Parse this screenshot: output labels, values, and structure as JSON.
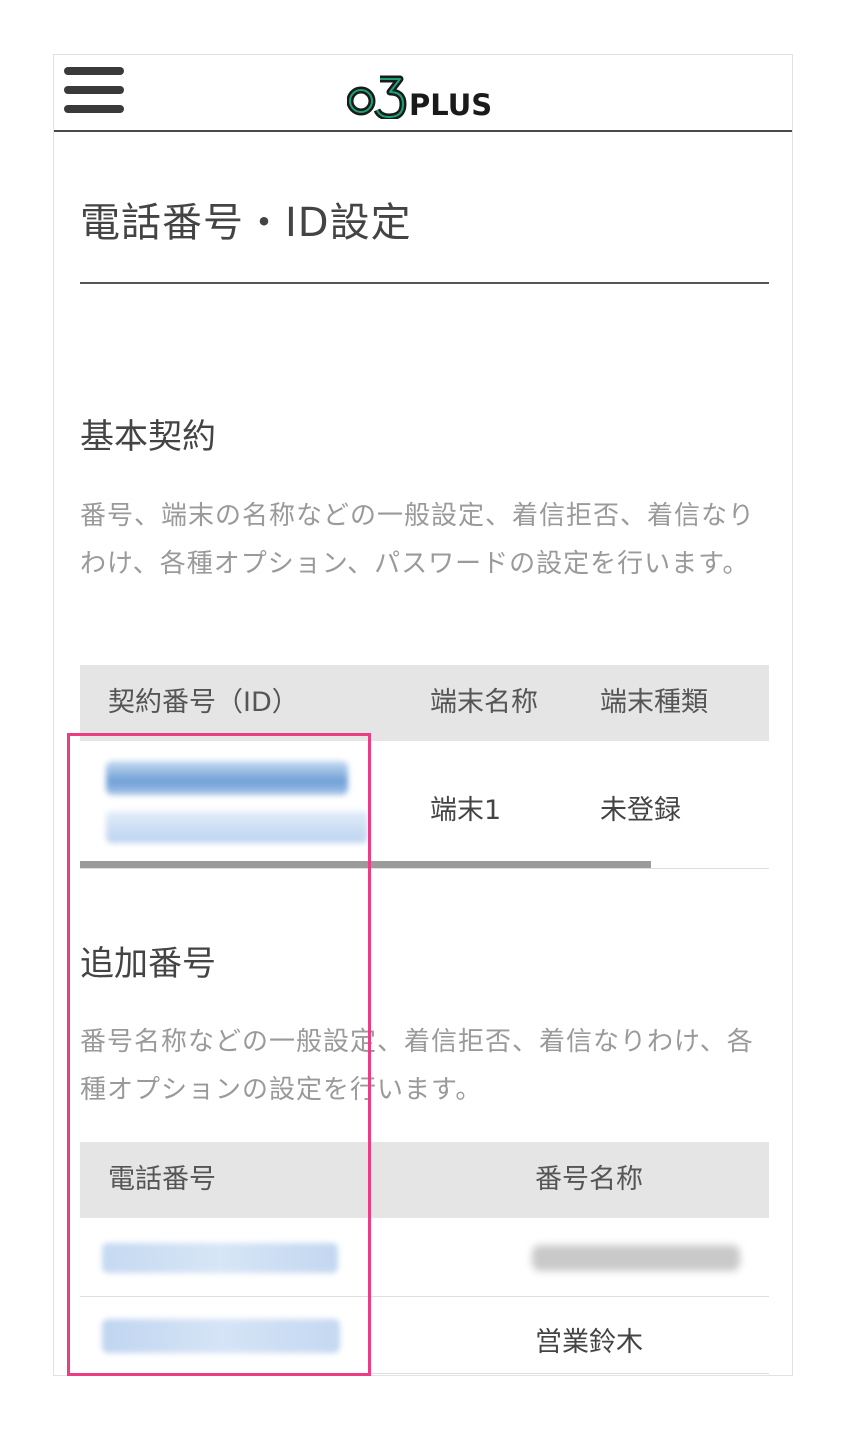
{
  "header": {
    "menu_icon": "hamburger-menu-icon",
    "logo_text": "o3plus",
    "logo_color": "#1a1a1a",
    "logo_accent_color": "#19a37a"
  },
  "page": {
    "title": "電話番号・ID設定"
  },
  "basic_contract": {
    "heading": "基本契約",
    "description": "番号、端末の名称などの一般設定、着信拒否、着信なりわけ、各種オプション、パスワードの設定を行います。",
    "columns": [
      "契約番号（ID）",
      "端末名称",
      "端末種類"
    ],
    "rows": [
      {
        "id": "",
        "terminal_name": "端末1",
        "terminal_type": "未登録"
      }
    ]
  },
  "additional_numbers": {
    "heading": "追加番号",
    "description": "番号名称などの一般設定、着信拒否、着信なりわけ、各種オプションの設定を行います。",
    "columns": [
      "電話番号",
      "番号名称"
    ],
    "rows": [
      {
        "phone": "",
        "name": ""
      },
      {
        "phone": "",
        "name": "営業鈴木"
      }
    ]
  },
  "colors": {
    "highlight": "#ea3d83",
    "table_header_bg": "#e5e5e5",
    "blurred_link": "#4a90d9"
  }
}
